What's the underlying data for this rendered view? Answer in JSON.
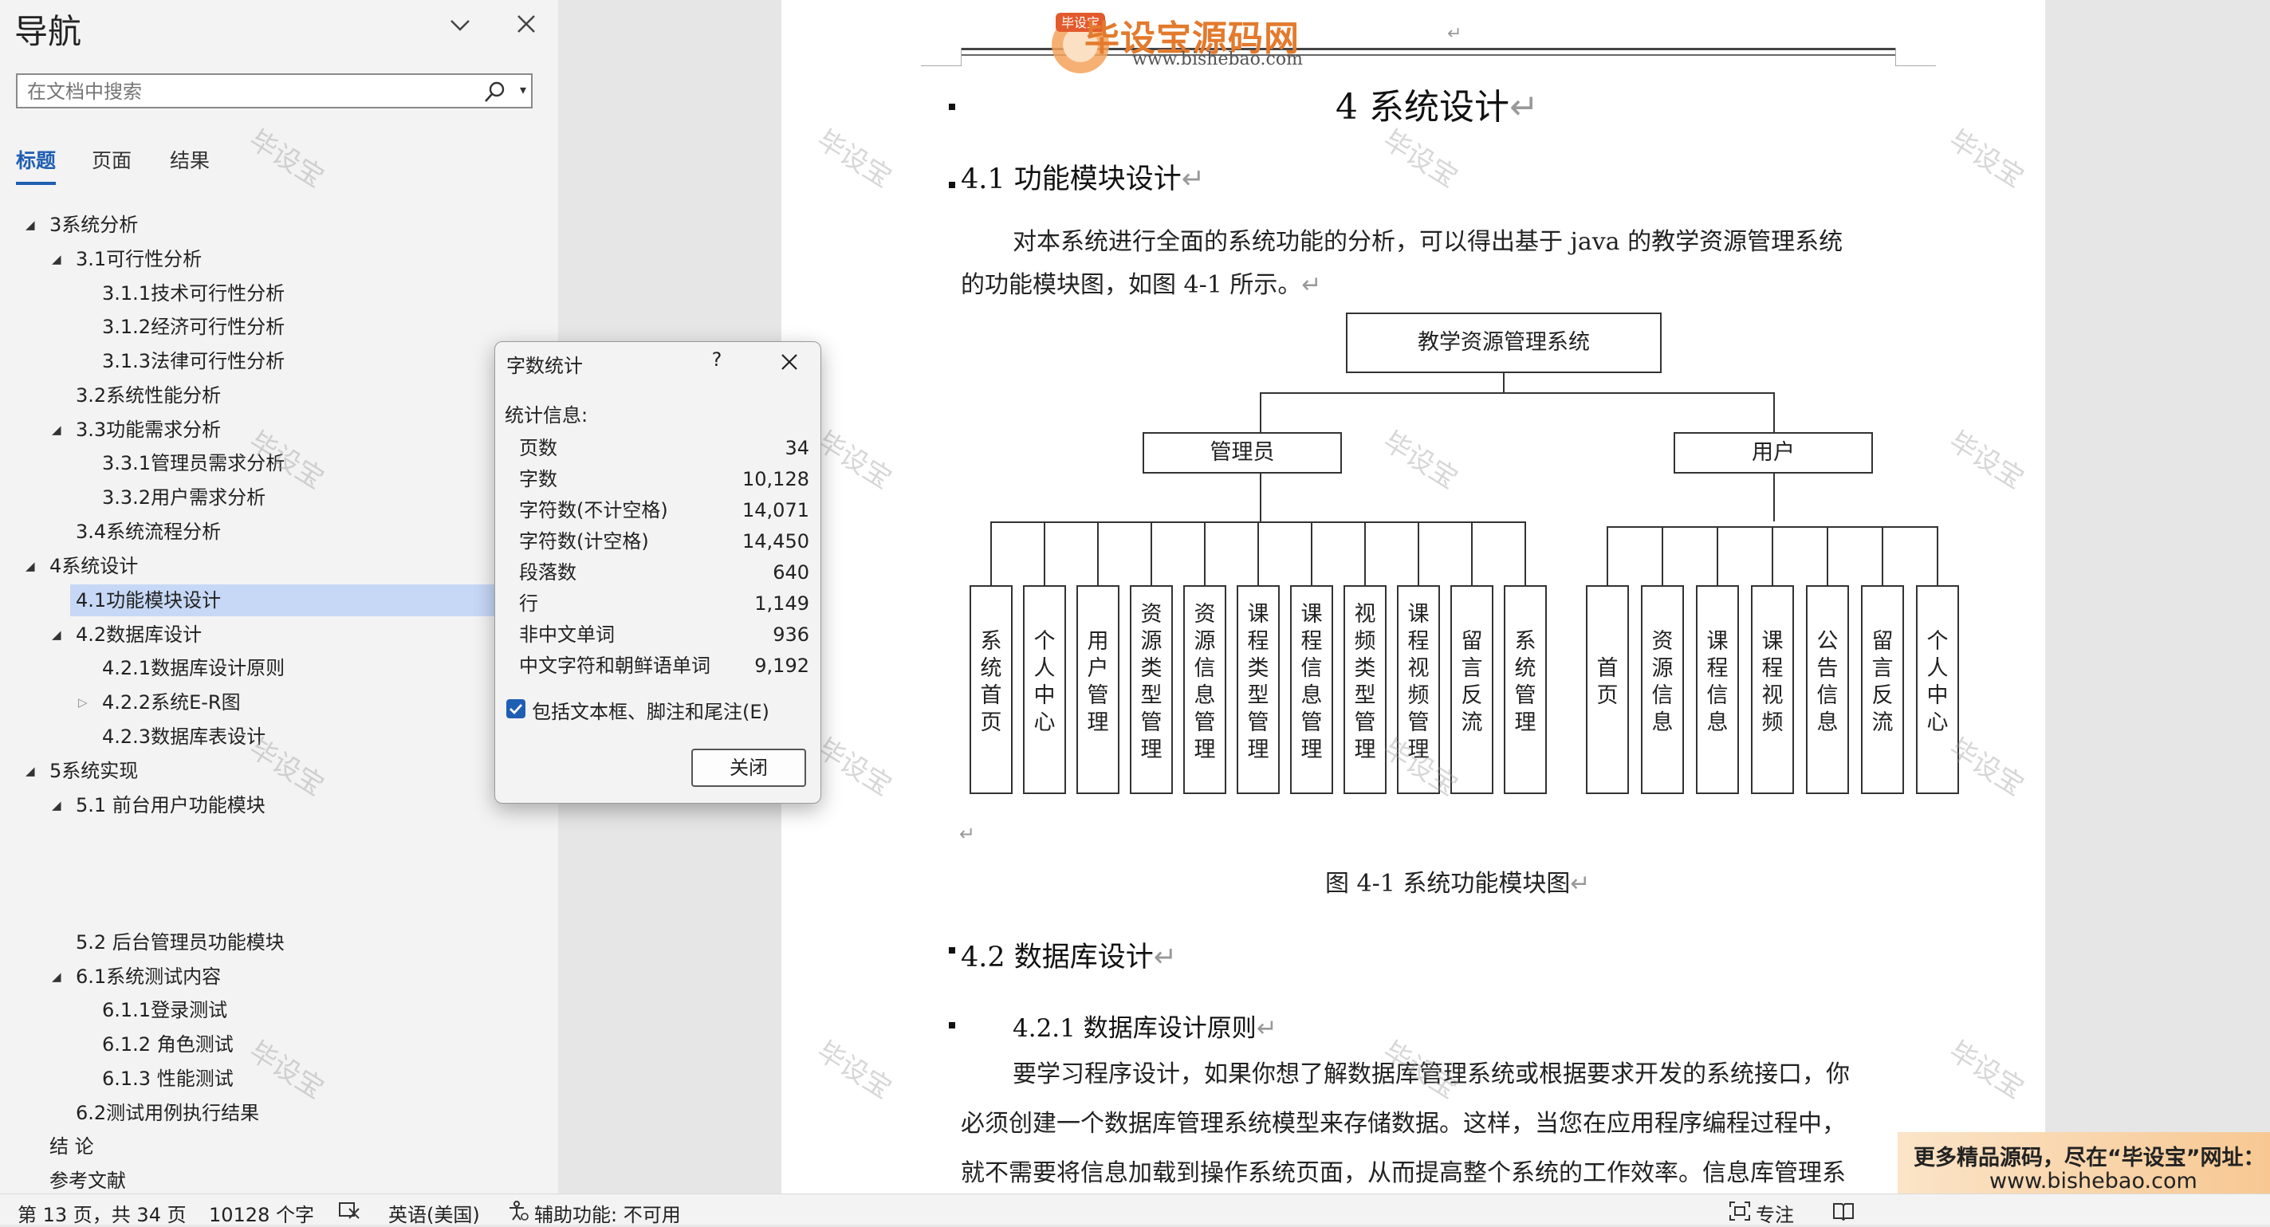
{
  "nav": {
    "title": "导航",
    "search_placeholder": "在文档中搜索",
    "tabs": [
      "标题",
      "页面",
      "结果"
    ],
    "tree": [
      {
        "label": "3系统分析",
        "level": 1,
        "expanded": true
      },
      {
        "label": "3.1可行性分析",
        "level": 2,
        "expanded": true
      },
      {
        "label": "3.1.1技术可行性分析",
        "level": 3
      },
      {
        "label": "3.1.2经济可行性分析",
        "level": 3
      },
      {
        "label": "3.1.3法律可行性分析",
        "level": 3
      },
      {
        "label": "3.2系统性能分析",
        "level": 2
      },
      {
        "label": "3.3功能需求分析",
        "level": 2,
        "expanded": true
      },
      {
        "label": "3.3.1管理员需求分析",
        "level": 3
      },
      {
        "label": "3.3.2用户需求分析",
        "level": 3
      },
      {
        "label": "3.4系统流程分析",
        "level": 2
      },
      {
        "label": "4系统设计",
        "level": 1,
        "expanded": true
      },
      {
        "label": "4.1功能模块设计",
        "level": 2,
        "selected": true
      },
      {
        "label": "4.2数据库设计",
        "level": 2,
        "expanded": true
      },
      {
        "label": "4.2.1数据库设计原则",
        "level": 3
      },
      {
        "label": "4.2.2系统E-R图",
        "level": 3,
        "collapsed": true
      },
      {
        "label": "4.2.3数据库表设计",
        "level": 3
      },
      {
        "label": "5系统实现",
        "level": 1,
        "expanded": true
      },
      {
        "label": "5.1 前台用户功能模块",
        "level": 2,
        "expanded": true
      },
      {
        "label": "5.2  后台管理员功能模块",
        "level": 2
      },
      {
        "label": "6.1系统测试内容",
        "level": 2,
        "expanded": true
      },
      {
        "label": "6.1.1登录测试",
        "level": 3
      },
      {
        "label": "6.1.2 角色测试",
        "level": 3
      },
      {
        "label": "6.1.3 性能测试",
        "level": 3
      },
      {
        "label": "6.2测试用例执行结果",
        "level": 2
      },
      {
        "label": "结  论",
        "level": 1
      },
      {
        "label": "参考文献",
        "level": 1
      }
    ]
  },
  "header": {
    "logo_badge": "毕设宝",
    "logo_text": "毕设宝源码网",
    "logo_url": "www.bishebao.com"
  },
  "document": {
    "chapter": "4 系统设计",
    "h41": "4.1 功能模块设计",
    "p1_line1": "对本系统进行全面的系统功能的分析，可以得出基于 java 的教学资源管理系统",
    "p1_line2": "的功能模块图，如图 4-1 所示。",
    "figure_caption": "图 4-1  系统功能模块图",
    "h42": "4.2 数据库设计",
    "h421": "4.2.1 数据库设计原则",
    "p2_line1": "要学习程序设计，如果你想了解数据库管理系统或根据要求开发的系统接口，你",
    "p2_line2": "必须创建一个数据库管理系统模型来存储数据。这样，当您在应用程序编程过程中，",
    "p2_line3": "就不需要将信息加载到操作系统页面，从而提高整个系统的工作效率。信息库管理系",
    "para_mark": "↵",
    "empty_para_mark": "↵"
  },
  "diagram": {
    "root": "教学资源管理系统",
    "admin": {
      "label": "管理员",
      "children": [
        "系统首页",
        "个人中心",
        "用户管理",
        "资源类型管理",
        "资源信息管理",
        "课程类型管理",
        "课程信息管理",
        "视频类型管理",
        "课程视频管理",
        "留言反流",
        "系统管理"
      ]
    },
    "user": {
      "label": "用户",
      "children": [
        "首页",
        "资源信息",
        "课程信息",
        "课程视频",
        "公告信息",
        "留言反流",
        "个人中心"
      ]
    }
  },
  "watermark_text": "毕设宝",
  "promo": {
    "line1": "更多精品源码，尽在“毕设宝”网址：",
    "line2": "www.bishebao.com"
  },
  "dialog": {
    "title": "字数统计",
    "help": "?",
    "stats_label": "统计信息:",
    "stats": [
      {
        "label": "页数",
        "value": "34"
      },
      {
        "label": "字数",
        "value": "10,128"
      },
      {
        "label": "字符数(不计空格)",
        "value": "14,071"
      },
      {
        "label": "字符数(计空格)",
        "value": "14,450"
      },
      {
        "label": "段落数",
        "value": "640"
      },
      {
        "label": "行",
        "value": "1,149"
      },
      {
        "label": "非中文单词",
        "value": "936"
      },
      {
        "label": "中文字符和朝鲜语单词",
        "value": "9,192"
      }
    ],
    "checkbox_label": "包括文本框、脚注和尾注(E)",
    "checkbox_checked": true,
    "close_label": "关闭"
  },
  "status": {
    "page_info": "第 13 页，共 34 页",
    "word_count": "10128 个字",
    "language": "英语(美国)",
    "accessibility": "辅助功能: 不可用",
    "focus": "专注"
  },
  "colors": {
    "accent": "#1f5fb3",
    "selected_row": "#c6d8f5",
    "logo_orange": "#e37a2d"
  }
}
